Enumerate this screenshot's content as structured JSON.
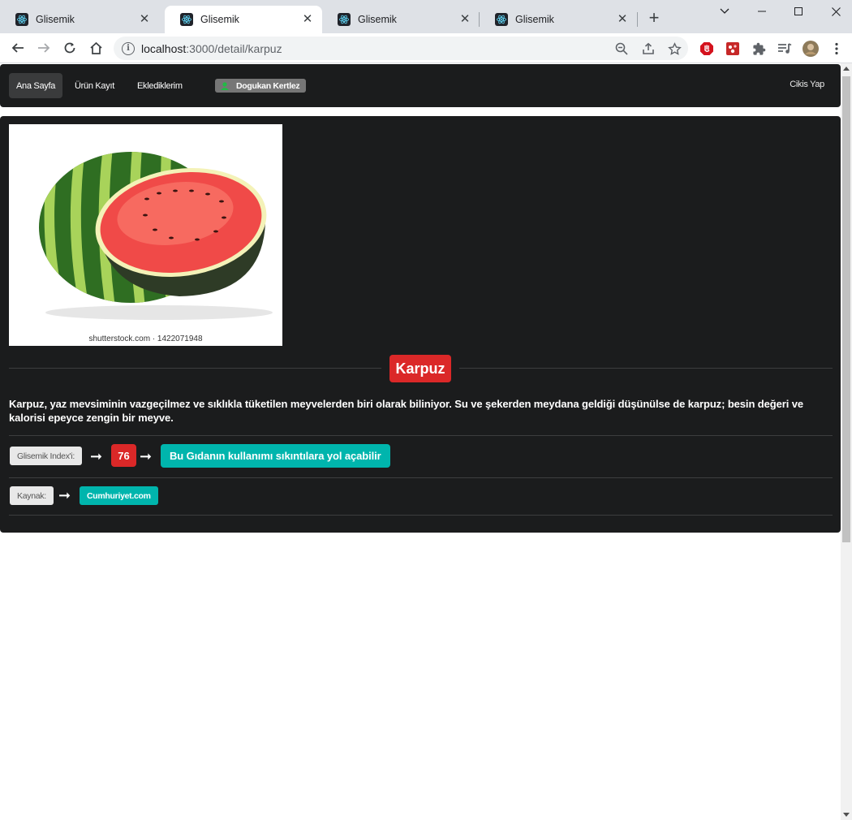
{
  "browser": {
    "tabs": [
      {
        "title": "Glisemik",
        "active": false
      },
      {
        "title": "Glisemik",
        "active": true
      },
      {
        "title": "Glisemik",
        "active": false
      },
      {
        "title": "Glisemik",
        "active": false
      }
    ],
    "url_host": "localhost",
    "url_rest": ":3000/detail/karpuz",
    "close_glyph": "✕",
    "new_tab_glyph": "+"
  },
  "navbar": {
    "items": [
      {
        "label": "Ana Sayfa",
        "active": true
      },
      {
        "label": "Ürün Kayıt",
        "active": false
      },
      {
        "label": "Eklediklerim",
        "active": false
      }
    ],
    "user": "Dogukan Kertlez",
    "logout": "Cikis Yap"
  },
  "detail": {
    "image_caption": "shutterstock.com · 1422071948",
    "title": "Karpuz",
    "description": "Karpuz, yaz mevsiminin vazgeçilmez ve sıklıkla tüketilen meyvelerden biri olarak biliniyor. Su ve şekerden meydana geldiği düşünülse de karpuz; besin değeri ve kalorisi epeyce zengin bir meyve.",
    "index_label": "Glisemik Index'i:",
    "index_value": "76",
    "index_warning": "Bu Gıdanın kullanımı sıkıntılara yol açabilir",
    "source_label": "Kaynak:",
    "source_value": "Cumhuriyet.com",
    "arrow_glyph": "➞"
  },
  "colors": {
    "dark_bg": "#1b1c1d",
    "red": "#db2828",
    "teal": "#00b5ad",
    "grey_label": "#e8e8e8"
  }
}
